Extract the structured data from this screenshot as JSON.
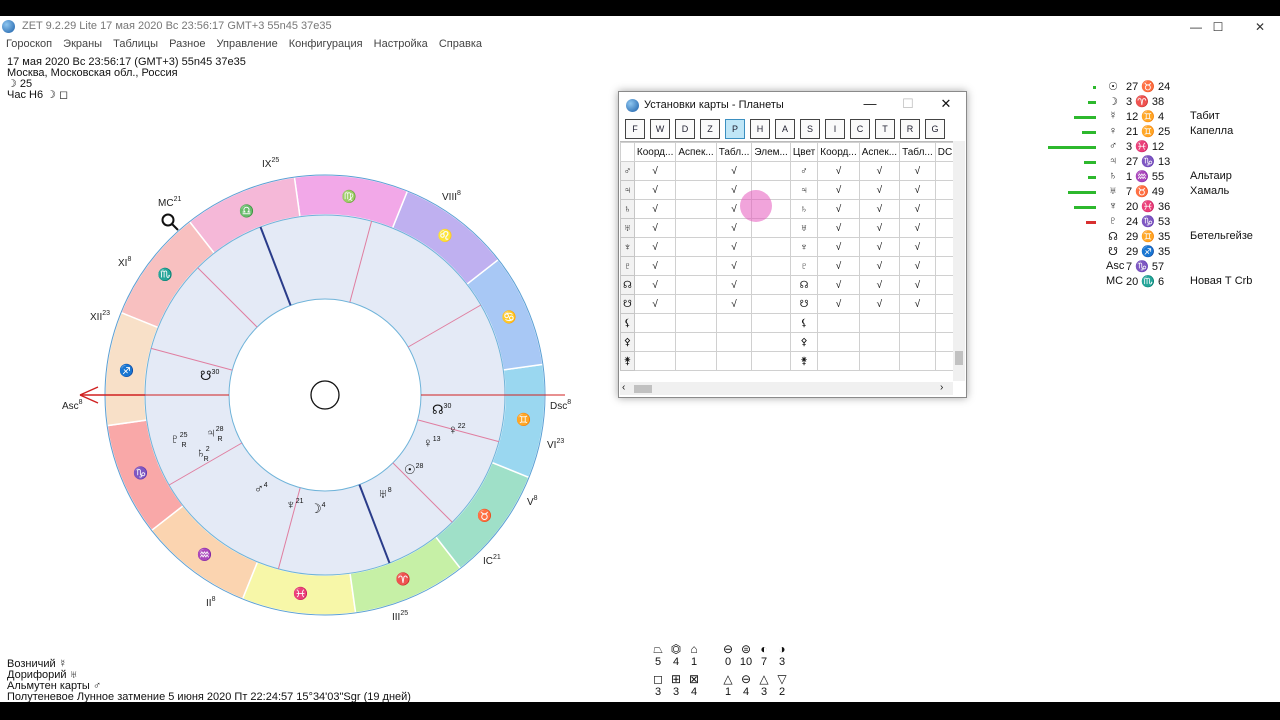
{
  "window": {
    "title": "ZET 9.2.29 Lite    17 мая 2020  Вс  23:56:17 GMT+3 55n45  37e35",
    "minimize": "—",
    "maximize": "☐",
    "close": "✕"
  },
  "menu": [
    "Гороскоп",
    "Экраны",
    "Таблицы",
    "Разное",
    "Управление",
    "Конфигурация",
    "Настройка",
    "Справка"
  ],
  "info": {
    "datetime": "17 мая 2020  Вс  23:56:17 (GMT+3) 55n45  37e35",
    "place": "Москва, Московская обл., Россия",
    "moon_day": "☽  25",
    "hour": "Час Н6  ☽ ◻"
  },
  "chart": {
    "signs": [
      "♈",
      "♉",
      "♊",
      "♋",
      "♌",
      "♍",
      "♎",
      "♏",
      "♐",
      "♑",
      "♒",
      "♓"
    ],
    "houses": [
      {
        "label": "Asc",
        "deg": "8"
      },
      {
        "label": "II",
        "deg": "8"
      },
      {
        "label": "III",
        "deg": "25"
      },
      {
        "label": "IC",
        "deg": "21"
      },
      {
        "label": "V",
        "deg": "8"
      },
      {
        "label": "VI",
        "deg": "23"
      },
      {
        "label": "Dsc",
        "deg": "8"
      },
      {
        "label": "VIII",
        "deg": "8"
      },
      {
        "label": "IX",
        "deg": "25"
      },
      {
        "label": "MC",
        "deg": "21"
      },
      {
        "label": "XI",
        "deg": "8"
      },
      {
        "label": "XII",
        "deg": "23"
      }
    ],
    "planets": [
      {
        "sym": "☋",
        "deg": "30"
      },
      {
        "sym": "♇",
        "deg": "25",
        "r": "R"
      },
      {
        "sym": "♃",
        "deg": "28",
        "r": "R"
      },
      {
        "sym": "♄",
        "deg": "2",
        "r": "R"
      },
      {
        "sym": "♂",
        "deg": "4"
      },
      {
        "sym": "♆",
        "deg": "21"
      },
      {
        "sym": "☽",
        "deg": "4"
      },
      {
        "sym": "♅",
        "deg": "8"
      },
      {
        "sym": "☉",
        "deg": "28"
      },
      {
        "sym": "♀",
        "deg": "13"
      },
      {
        "sym": "♀",
        "deg": "22"
      },
      {
        "sym": "☊",
        "deg": "30"
      }
    ]
  },
  "legend": [
    {
      "sym": "☉",
      "val": "27 ♉ 24",
      "star": "",
      "bar": "#2db82d",
      "w": 3
    },
    {
      "sym": "☽",
      "val": "3 ♈ 38",
      "star": "",
      "bar": "#2db82d",
      "w": 8
    },
    {
      "sym": "☿",
      "val": "12 ♊ 4",
      "star": "Табит",
      "bar": "#2db82d",
      "w": 22
    },
    {
      "sym": "♀",
      "val": "21 ♊ 25",
      "star": "Капелла",
      "bar": "#2db82d",
      "w": 14
    },
    {
      "sym": "♂",
      "val": "3 ♓ 12",
      "star": "",
      "bar": "#2db82d",
      "w": 48
    },
    {
      "sym": "♃",
      "val": "27 ♑ 13",
      "star": "",
      "bar": "#2db82d",
      "w": 12
    },
    {
      "sym": "♄",
      "val": "1 ♒ 55",
      "star": "Альтаир",
      "bar": "#2db82d",
      "w": 8
    },
    {
      "sym": "♅",
      "val": "7 ♉ 49",
      "star": "Хамаль",
      "bar": "#2db82d",
      "w": 28
    },
    {
      "sym": "♆",
      "val": "20 ♓ 36",
      "star": "",
      "bar": "#2db82d",
      "w": 22
    },
    {
      "sym": "♇",
      "val": "24 ♑ 53",
      "star": "",
      "bar": "#d83030",
      "w": 10
    },
    {
      "sym": "☊",
      "val": "29 ♊ 35",
      "star": "Бетельгейзе",
      "bar": "",
      "w": 0
    },
    {
      "sym": "☋",
      "val": "29 ♐ 35",
      "star": "",
      "bar": "",
      "w": 0
    },
    {
      "sym": "Asc",
      "val": "7 ♑ 57",
      "star": "",
      "bar": "",
      "w": 0
    },
    {
      "sym": "MC",
      "val": "20 ♏ 6",
      "star": "Новая Т Crb",
      "bar": "",
      "w": 0
    }
  ],
  "bottom_left": {
    "line1": "Возничий  ☿",
    "line2": "Дорифорий  ♅",
    "line3": "Альмутен карты  ♂",
    "line4": "Полутеневое Лунное затмение 5 июня 2020 Пт 22:24:57 15°34'03\"Sgr (19 дней)"
  },
  "stats_top": [
    {
      "sym": "⏢",
      "num": "5"
    },
    {
      "sym": "⏣",
      "num": "4"
    },
    {
      "sym": "⌂",
      "num": "1"
    },
    {
      "sym": "⊖",
      "num": "0"
    },
    {
      "sym": "⊜",
      "num": "10"
    },
    {
      "sym": "◐",
      "num": "7"
    },
    {
      "sym": "◑",
      "num": "3"
    }
  ],
  "stats_bottom": [
    {
      "sym": "◻",
      "num": "3"
    },
    {
      "sym": "⊞",
      "num": "3"
    },
    {
      "sym": "⊠",
      "num": "4"
    },
    {
      "sym": "△",
      "num": "1"
    },
    {
      "sym": "⊖",
      "num": "4"
    },
    {
      "sym": "△",
      "num": "3"
    },
    {
      "sym": "▽",
      "num": "2"
    }
  ],
  "dialog": {
    "title": "Установки карты - Планеты",
    "minimize": "—",
    "maximize": "☐",
    "close": "✕",
    "toolbar": [
      "F",
      "W",
      "D",
      "Z",
      "P",
      "H",
      "A",
      "S",
      "I",
      "C",
      "T",
      "R",
      "G"
    ],
    "columns": [
      "Коорд...",
      "Аспек...",
      "Табл...",
      "Элем...",
      "Цвет",
      "Коорд...",
      "Аспек...",
      "Табл...",
      "DC"
    ],
    "rows": [
      {
        "sym": "♂",
        "cells": [
          "√",
          "",
          "√",
          "",
          "♂",
          "√",
          "√",
          "√",
          ""
        ]
      },
      {
        "sym": "♃",
        "cells": [
          "√",
          "",
          "√",
          "",
          "♃",
          "√",
          "√",
          "√",
          ""
        ]
      },
      {
        "sym": "♄",
        "cells": [
          "√",
          "",
          "√",
          "",
          "♄",
          "√",
          "√",
          "√",
          ""
        ]
      },
      {
        "sym": "♅",
        "cells": [
          "√",
          "",
          "√",
          "",
          "♅",
          "√",
          "√",
          "√",
          ""
        ]
      },
      {
        "sym": "♆",
        "cells": [
          "√",
          "",
          "√",
          "",
          "♆",
          "√",
          "√",
          "√",
          ""
        ]
      },
      {
        "sym": "♇",
        "cells": [
          "√",
          "",
          "√",
          "",
          "♇",
          "√",
          "√",
          "√",
          ""
        ]
      },
      {
        "sym": "☊",
        "cells": [
          "√",
          "",
          "√",
          "",
          "☊",
          "√",
          "√",
          "√",
          ""
        ]
      },
      {
        "sym": "☋",
        "cells": [
          "√",
          "",
          "√",
          "",
          "☋",
          "√",
          "√",
          "√",
          ""
        ]
      },
      {
        "sym": "⚸",
        "cells": [
          "",
          "",
          "",
          "",
          "⚸",
          "",
          "",
          "",
          ""
        ]
      },
      {
        "sym": "⚴",
        "cells": [
          "",
          "",
          "",
          "",
          "⚴",
          "",
          "",
          "",
          ""
        ]
      },
      {
        "sym": "⚵",
        "cells": [
          "",
          "",
          "",
          "",
          "⚵",
          "",
          "",
          "",
          ""
        ]
      }
    ]
  }
}
